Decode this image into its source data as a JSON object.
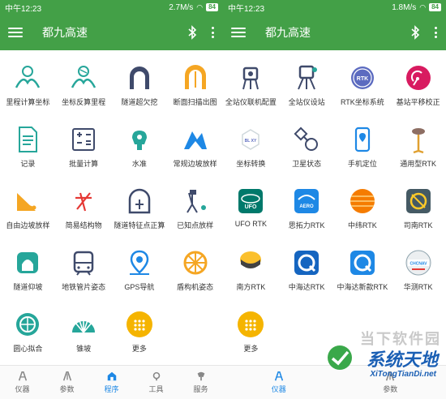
{
  "status_left": {
    "time": "中午12:23",
    "speed": "2.7M/s",
    "battery": "84"
  },
  "status_right": {
    "time": "中午12:23",
    "speed": "1.8M/s",
    "battery": "84"
  },
  "app_title": "都九高速",
  "left_grid": [
    {
      "label": "里程计算坐标",
      "icon": "mileage-coordinate-icon"
    },
    {
      "label": "坐标反算里程",
      "icon": "coordinate-reverse-icon"
    },
    {
      "label": "隧道超欠挖",
      "icon": "tunnel-overbreak-icon"
    },
    {
      "label": "断面扫描出图",
      "icon": "section-scan-icon"
    },
    {
      "label": "记录",
      "icon": "record-document-icon"
    },
    {
      "label": "批量计算",
      "icon": "calculator-icon"
    },
    {
      "label": "水准",
      "icon": "level-instrument-icon"
    },
    {
      "label": "常规边坡放样",
      "icon": "slope-stakeout-icon"
    },
    {
      "label": "自由边坡放样",
      "icon": "free-slope-icon"
    },
    {
      "label": "简易结构物",
      "icon": "structure-icon"
    },
    {
      "label": "隧道特征点正算",
      "icon": "tunnel-feature-icon"
    },
    {
      "label": "已知点放样",
      "icon": "known-point-icon"
    },
    {
      "label": "隧道仰坡",
      "icon": "tunnel-slope-icon"
    },
    {
      "label": "地铁管片姿态",
      "icon": "subway-segment-icon"
    },
    {
      "label": "GPS导航",
      "icon": "gps-navigation-icon"
    },
    {
      "label": "盾构机姿态",
      "icon": "shield-machine-icon"
    },
    {
      "label": "圆心拟合",
      "icon": "circle-fit-icon"
    },
    {
      "label": "锥坡",
      "icon": "cone-slope-icon"
    },
    {
      "label": "更多",
      "icon": "more-apps-icon"
    }
  ],
  "right_grid": [
    {
      "label": "全站仪联机配置",
      "icon": "total-station-config-icon"
    },
    {
      "label": "全站仪设站",
      "icon": "total-station-setup-icon"
    },
    {
      "label": "RTK坐标系统",
      "icon": "rtk-coordinate-icon",
      "badge": "RTK"
    },
    {
      "label": "基站平移校正",
      "icon": "base-station-icon"
    },
    {
      "label": "坐标转换",
      "icon": "coordinate-transform-icon",
      "badge": "BL XY"
    },
    {
      "label": "卫星状态",
      "icon": "satellite-status-icon"
    },
    {
      "label": "手机定位",
      "icon": "phone-location-icon"
    },
    {
      "label": "通用型RTK",
      "icon": "generic-rtk-icon"
    },
    {
      "label": "UFO RTK",
      "icon": "ufo-rtk-icon",
      "badge": "UFO"
    },
    {
      "label": "思拓力RTK",
      "icon": "stonex-rtk-icon",
      "badge": "AERO"
    },
    {
      "label": "中纬RTK",
      "icon": "geomax-rtk-icon"
    },
    {
      "label": "司南RTK",
      "icon": "comnav-rtk-icon"
    },
    {
      "label": "南方RTK",
      "icon": "south-rtk-icon"
    },
    {
      "label": "中海达RTK",
      "icon": "hi-target-rtk-icon"
    },
    {
      "label": "中海达新款RTK",
      "icon": "hi-target-new-rtk-icon"
    },
    {
      "label": "华测RTK",
      "icon": "chcnav-rtk-icon",
      "badge": "CHCNAV"
    },
    {
      "label": "更多",
      "icon": "more-apps-icon"
    }
  ],
  "left_tabs": [
    {
      "label": "仪器",
      "active": false
    },
    {
      "label": "参数",
      "active": false
    },
    {
      "label": "程序",
      "active": true
    },
    {
      "label": "工具",
      "active": false
    },
    {
      "label": "服务",
      "active": false
    }
  ],
  "right_tabs": [
    {
      "label": "仪器",
      "active": true
    },
    {
      "label": "参数",
      "active": false
    }
  ],
  "watermark": {
    "top": "当下软件园",
    "main": "系统天地",
    "url": "XiTongTianDi.net"
  },
  "colors": {
    "green": "#43a047",
    "blue": "#1e88e5",
    "orange": "#f5a623",
    "teal": "#26a69a",
    "navy": "#3f4a6b"
  }
}
